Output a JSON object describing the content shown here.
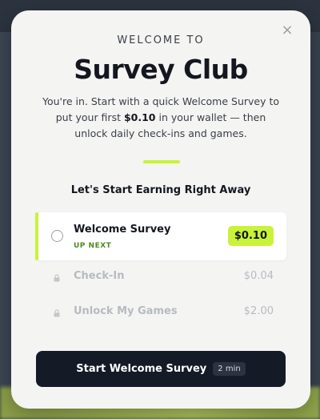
{
  "modal": {
    "close_glyph": "×",
    "eyebrow": "WELCOME TO",
    "title": "Survey Club",
    "subtitle_part1": "You're in. Start with a quick Welcome Survey to put your first ",
    "subtitle_amount": "$0.10",
    "subtitle_part2": " in your wallet — then unlock daily check-ins and games.",
    "section_heading": "Let's Start Earning Right Away"
  },
  "tasks": [
    {
      "name": "Welcome Survey",
      "tag": "UP NEXT",
      "reward": "$0.10",
      "state": "active"
    },
    {
      "name": "Check-In",
      "reward": "$0.04",
      "state": "locked"
    },
    {
      "name": "Unlock My Games",
      "reward": "$2.00",
      "state": "locked"
    }
  ],
  "cta": {
    "label": "Start Welcome Survey",
    "duration": "2 min"
  },
  "colors": {
    "accent": "#c9f23a",
    "primary_dark": "#141a26",
    "up_next_green": "#4e8a1e",
    "muted": "#b7bbc0"
  },
  "icons": {
    "close": "close-icon",
    "radio": "radio-circle-icon",
    "lock": "lock-icon"
  }
}
